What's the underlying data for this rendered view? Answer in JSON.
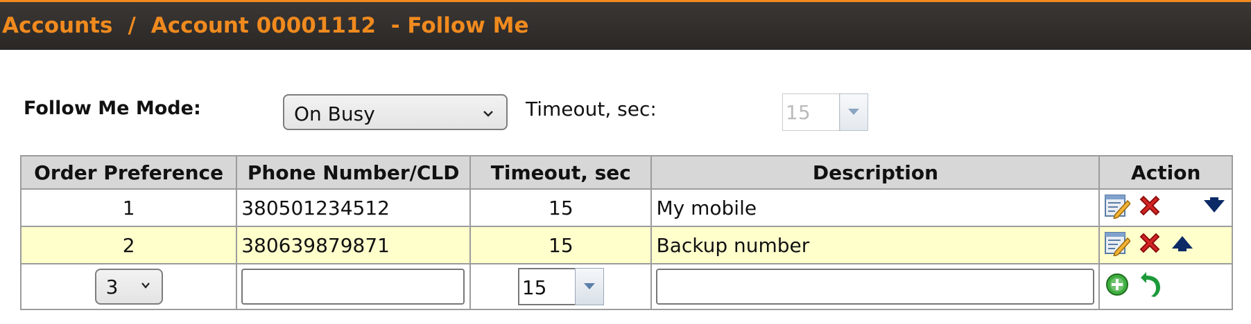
{
  "breadcrumb": {
    "accounts": "Accounts",
    "separator": "/",
    "account": "Account 00001112",
    "page": "- Follow Me"
  },
  "mode": {
    "label": "Follow Me Mode:",
    "value": "On Busy"
  },
  "timeout": {
    "label": "Timeout, sec:",
    "value": "15",
    "disabled": true
  },
  "table": {
    "headers": [
      "Order Preference",
      "Phone Number/CLD",
      "Timeout, sec",
      "Description",
      "Action"
    ],
    "rows": [
      {
        "order": "1",
        "phone": "380501234512",
        "timeout": "15",
        "description": "My mobile",
        "move": "down"
      },
      {
        "order": "2",
        "phone": "380639879871",
        "timeout": "15",
        "description": "Backup number",
        "move": "up"
      }
    ],
    "new_row": {
      "order": "3",
      "phone": "",
      "timeout": "15",
      "description": ""
    }
  },
  "icons": {
    "edit": "edit-icon",
    "delete": "delete-icon",
    "move_down": "arrow-down-icon",
    "move_up": "arrow-up-icon",
    "add": "add-icon",
    "undo": "undo-icon"
  },
  "colors": {
    "accent": "#f08a1e",
    "header_bg": "#2f2b29",
    "row_alt": "#ffffcc",
    "table_header_bg": "#d7d7d7"
  }
}
